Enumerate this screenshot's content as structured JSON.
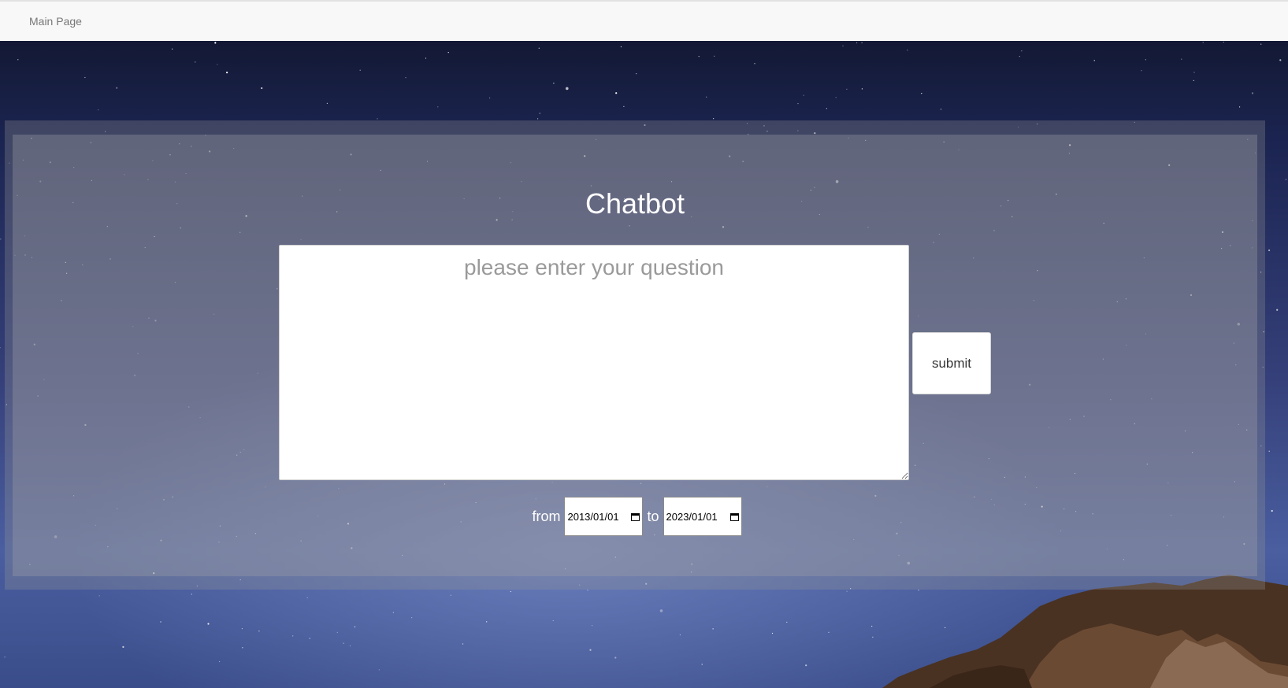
{
  "nav": {
    "main_page_label": "Main Page"
  },
  "chatbot": {
    "title": "Chatbot",
    "question_placeholder": "please enter your question",
    "question_value": "",
    "submit_label": "submit"
  },
  "date_range": {
    "from_label": "from",
    "from_value": "2013/01/01",
    "to_label": "to",
    "to_value": "2023/01/01"
  },
  "icons": {
    "calendar": "calendar-icon"
  },
  "colors": {
    "navbar_bg": "#f8f8f8",
    "nav_text": "#777777",
    "title_text": "#ffffff",
    "panel_overlay": "rgba(150,150,150,0.30)"
  }
}
